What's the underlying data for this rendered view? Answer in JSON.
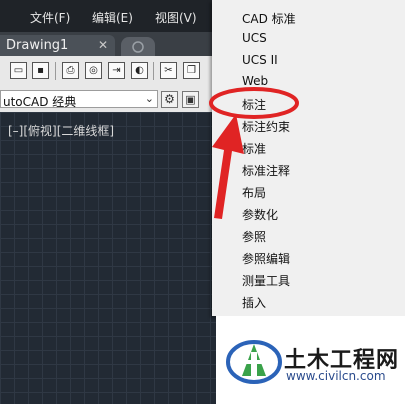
{
  "menubar": {
    "items": [
      {
        "label": "文件(F)"
      },
      {
        "label": "编辑(E)"
      },
      {
        "label": "视图(V)"
      }
    ]
  },
  "tabs": {
    "document": "Drawing1",
    "close_glyph": "✕"
  },
  "workspace": {
    "selected": "utoCAD 经典",
    "arrow": "⌄"
  },
  "viewport": {
    "label": "[–][俯视][二维线框]"
  },
  "dropdown": {
    "items": [
      {
        "label": "CAD 标准"
      },
      {
        "label": "UCS"
      },
      {
        "label": "UCS II"
      },
      {
        "label": "Web"
      },
      {
        "label": "标注"
      },
      {
        "label": "标注约束"
      },
      {
        "label": "标准"
      },
      {
        "label": "标准注释"
      },
      {
        "label": "布局"
      },
      {
        "label": "参数化"
      },
      {
        "label": "参照"
      },
      {
        "label": "参照编辑"
      },
      {
        "label": "测量工具"
      },
      {
        "label": "插入"
      }
    ],
    "checked_index": 6,
    "check_glyph": "✓"
  },
  "annotation": {
    "color": "#e02424"
  },
  "watermark": {
    "title": "土木工程网",
    "url": "www.civilcn.com"
  }
}
